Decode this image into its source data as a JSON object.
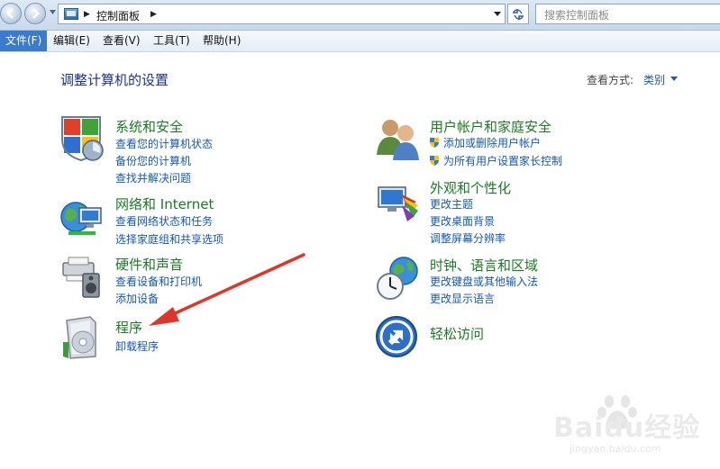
{
  "address_bar": {
    "breadcrumb": "控制面板",
    "search_placeholder": "搜索控制面板"
  },
  "menu": [
    "文件(F)",
    "编辑(E)",
    "查看(V)",
    "工具(T)",
    "帮助(H)"
  ],
  "header": {
    "title": "调整计算机的设置",
    "view_label": "查看方式:",
    "view_value": "类别"
  },
  "categories": {
    "system": {
      "title": "系统和安全",
      "links": [
        "查看您的计算机状态",
        "备份您的计算机",
        "查找并解决问题"
      ]
    },
    "network": {
      "title": "网络和 Internet",
      "links": [
        "查看网络状态和任务",
        "选择家庭组和共享选项"
      ]
    },
    "hardware": {
      "title": "硬件和声音",
      "links": [
        "查看设备和打印机",
        "添加设备"
      ]
    },
    "programs": {
      "title": "程序",
      "links": [
        "卸载程序"
      ]
    },
    "users": {
      "title": "用户帐户和家庭安全",
      "links": [
        "添加或删除用户帐户",
        "为所有用户设置家长控制"
      ]
    },
    "appearance": {
      "title": "外观和个性化",
      "links": [
        "更改主题",
        "更改桌面背景",
        "调整屏幕分辨率"
      ]
    },
    "clock": {
      "title": "时钟、语言和区域",
      "links": [
        "更改键盘或其他输入法",
        "更改显示语言"
      ]
    },
    "ease": {
      "title": "轻松访问",
      "links": []
    }
  },
  "watermark": {
    "brand": "Baidu经验",
    "url": "jingyan.baidu.com"
  },
  "colors": {
    "category_title": "#1c7a25",
    "link": "#1557b5",
    "page_title": "#1e3287",
    "annotation_arrow": "#e0352b",
    "menu_active": "#3a7bd0"
  }
}
